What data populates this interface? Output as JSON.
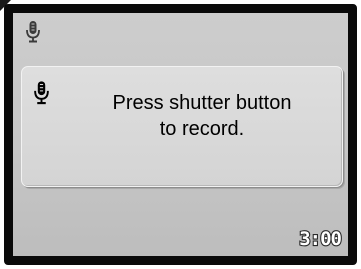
{
  "status_bar": {
    "mode_icon": "microphone-icon"
  },
  "dialog": {
    "icon": "microphone-icon",
    "message_line1": "Press shutter button",
    "message_line2": "to record."
  },
  "recording_time": "3:00",
  "colors": {
    "screen_border": "#0a0a0a",
    "screen_bg": "#c8c8c8",
    "dialog_bg": "#d9d9d9",
    "text": "#000000"
  }
}
